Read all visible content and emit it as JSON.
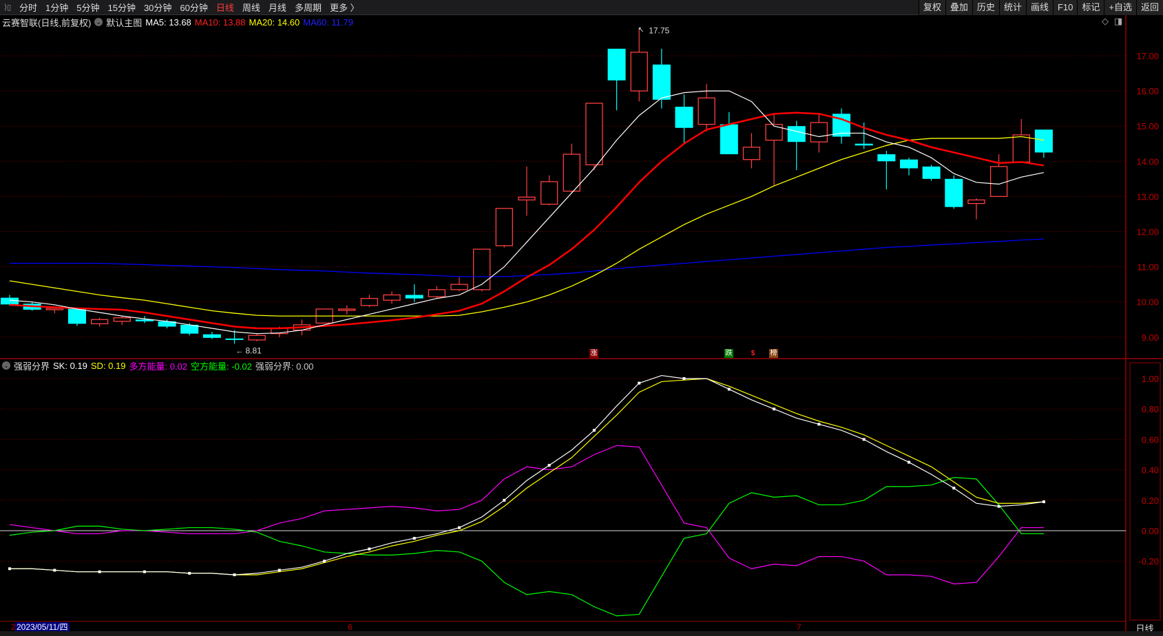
{
  "toolbar": {
    "periods": [
      "分时",
      "1分钟",
      "5分钟",
      "15分钟",
      "30分钟",
      "60分钟",
      "日线",
      "周线",
      "月线",
      "多周期",
      "更多 〉"
    ],
    "active": "日线",
    "buttons": [
      "复权",
      "叠加",
      "历史",
      "统计",
      "画线",
      "F10",
      "标记",
      "+自选",
      "返回"
    ]
  },
  "info": {
    "title": "云赛智联(日线,前复权)",
    "main_label": "默认主图",
    "ma5": "MA5: 13.68",
    "ma10": "MA10: 13.88",
    "ma20": "MA20: 14.60",
    "ma60": "MA60: 11.79"
  },
  "indicator": {
    "name": "强弱分界",
    "sk": "SK: 0.19",
    "sd": "SD: 0.19",
    "long": "多方能量: 0.02",
    "short": "空方能量: -0.02",
    "bound": "强弱分界: 0.00"
  },
  "tags": {
    "up": "涨",
    "down": "跌",
    "s": "$",
    "rank": "榜"
  },
  "annotations": {
    "high": "17.75",
    "low": "8.81"
  },
  "date_axis": {
    "current": "2023/05/11/四",
    "months": [
      "2",
      "6",
      "7"
    ],
    "period": "日线"
  },
  "colors": {
    "up": "#ff4040",
    "down": "#00ffff",
    "ma5": "#ffffff",
    "ma10": "#ff0000",
    "ma20": "#ffff00",
    "ma60": "#0000ff",
    "sk": "#ffffff",
    "sd": "#ffff00",
    "long": "#ff00ff",
    "short": "#00ff00"
  },
  "chart_data": [
    {
      "type": "candlestick",
      "title": "云赛智联 日线",
      "ylim": [
        8.6,
        17.9
      ],
      "yticks": [
        "17.00",
        "16.00",
        "15.00",
        "14.00",
        "13.00",
        "12.00",
        "11.00",
        "10.00",
        "9.00"
      ],
      "ohlc": [
        [
          10.12,
          10.2,
          9.9,
          9.93
        ],
        [
          9.95,
          10.0,
          9.75,
          9.78
        ],
        [
          9.78,
          9.85,
          9.68,
          9.82
        ],
        [
          9.82,
          9.85,
          9.32,
          9.38
        ],
        [
          9.38,
          9.55,
          9.3,
          9.5
        ],
        [
          9.45,
          9.6,
          9.35,
          9.55
        ],
        [
          9.5,
          9.6,
          9.4,
          9.45
        ],
        [
          9.45,
          9.5,
          9.25,
          9.3
        ],
        [
          9.35,
          9.4,
          9.05,
          9.1
        ],
        [
          9.08,
          9.15,
          8.95,
          8.98
        ],
        [
          8.96,
          9.2,
          8.81,
          8.95
        ],
        [
          8.92,
          9.1,
          8.88,
          9.05
        ],
        [
          9.1,
          9.3,
          9.0,
          9.25
        ],
        [
          9.2,
          9.5,
          9.05,
          9.35
        ],
        [
          9.4,
          9.8,
          9.4,
          9.8
        ],
        [
          9.8,
          9.9,
          9.65,
          9.8
        ],
        [
          9.9,
          10.2,
          9.85,
          10.1
        ],
        [
          10.05,
          10.3,
          9.95,
          10.2
        ],
        [
          10.2,
          10.5,
          10.0,
          10.1
        ],
        [
          10.15,
          10.45,
          10.1,
          10.35
        ],
        [
          10.35,
          10.7,
          10.3,
          10.5
        ],
        [
          10.35,
          11.5,
          10.3,
          11.5
        ],
        [
          11.6,
          12.66,
          11.55,
          12.66
        ],
        [
          12.9,
          13.85,
          12.45,
          12.98
        ],
        [
          12.78,
          13.6,
          12.75,
          13.42
        ],
        [
          13.15,
          14.5,
          13.1,
          14.2
        ],
        [
          13.9,
          15.65,
          13.75,
          15.65
        ],
        [
          17.2,
          17.2,
          15.45,
          16.3
        ],
        [
          16.0,
          17.75,
          15.7,
          17.1
        ],
        [
          16.75,
          17.2,
          15.5,
          15.75
        ],
        [
          15.55,
          15.9,
          14.5,
          14.95
        ],
        [
          15.05,
          16.2,
          14.85,
          15.8
        ],
        [
          15.05,
          15.4,
          14.2,
          14.2
        ],
        [
          14.05,
          14.8,
          13.8,
          14.4
        ],
        [
          14.6,
          15.35,
          13.3,
          15.05
        ],
        [
          15.0,
          15.15,
          13.75,
          14.55
        ],
        [
          14.55,
          15.35,
          14.25,
          15.1
        ],
        [
          15.35,
          15.5,
          14.5,
          14.7
        ],
        [
          14.5,
          15.1,
          14.35,
          14.45
        ],
        [
          14.2,
          14.3,
          13.2,
          14.0
        ],
        [
          14.05,
          14.1,
          13.6,
          13.8
        ],
        [
          13.85,
          13.9,
          13.45,
          13.5
        ],
        [
          13.5,
          13.6,
          12.65,
          12.7
        ],
        [
          12.8,
          12.95,
          12.35,
          12.9
        ],
        [
          13.0,
          14.2,
          13.0,
          13.85
        ],
        [
          13.98,
          15.2,
          13.95,
          14.75
        ],
        [
          14.9,
          14.9,
          14.1,
          14.25
        ]
      ],
      "ma5": [
        10.05,
        10.0,
        9.92,
        9.8,
        9.7,
        9.6,
        9.52,
        9.45,
        9.35,
        9.25,
        9.15,
        9.1,
        9.12,
        9.2,
        9.35,
        9.5,
        9.65,
        9.8,
        9.95,
        10.1,
        10.2,
        10.5,
        11.0,
        11.7,
        12.4,
        13.1,
        13.8,
        14.6,
        15.3,
        15.8,
        15.95,
        16.0,
        16.0,
        15.7,
        15.0,
        14.85,
        14.7,
        14.8,
        14.8,
        14.55,
        14.4,
        14.1,
        13.65,
        13.4,
        13.35,
        13.55,
        13.68
      ],
      "ma10": [
        9.92,
        9.88,
        9.85,
        9.82,
        9.8,
        9.78,
        9.7,
        9.6,
        9.5,
        9.4,
        9.3,
        9.25,
        9.25,
        9.28,
        9.32,
        9.36,
        9.42,
        9.48,
        9.55,
        9.65,
        9.75,
        9.95,
        10.3,
        10.7,
        11.05,
        11.5,
        12.05,
        12.7,
        13.4,
        14.0,
        14.5,
        14.9,
        15.05,
        15.2,
        15.35,
        15.38,
        15.35,
        15.2,
        14.95,
        14.75,
        14.6,
        14.4,
        14.25,
        14.1,
        13.95,
        13.98,
        13.88
      ],
      "ma20": [
        10.6,
        10.5,
        10.4,
        10.3,
        10.2,
        10.12,
        10.05,
        9.95,
        9.85,
        9.75,
        9.68,
        9.62,
        9.6,
        9.6,
        9.6,
        9.6,
        9.6,
        9.6,
        9.6,
        9.6,
        9.62,
        9.72,
        9.85,
        10.0,
        10.2,
        10.45,
        10.75,
        11.1,
        11.5,
        11.85,
        12.2,
        12.5,
        12.75,
        13.0,
        13.3,
        13.55,
        13.8,
        14.05,
        14.25,
        14.45,
        14.6,
        14.65,
        14.65,
        14.65,
        14.65,
        14.7,
        14.6
      ],
      "ma60": [
        11.1,
        11.1,
        11.1,
        11.1,
        11.1,
        11.08,
        11.06,
        11.04,
        11.02,
        11.0,
        10.98,
        10.95,
        10.92,
        10.9,
        10.88,
        10.85,
        10.82,
        10.8,
        10.78,
        10.75,
        10.72,
        10.72,
        10.72,
        10.75,
        10.78,
        10.82,
        10.88,
        10.95,
        11.0,
        11.05,
        11.1,
        11.15,
        11.2,
        11.25,
        11.3,
        11.35,
        11.4,
        11.45,
        11.5,
        11.55,
        11.58,
        11.62,
        11.65,
        11.69,
        11.72,
        11.76,
        11.79
      ]
    },
    {
      "type": "line",
      "title": "强弱分界",
      "ylim": [
        -0.3,
        1.1
      ],
      "yticks": [
        "1.00",
        "0.80",
        "0.60",
        "0.40",
        "0.20",
        "0.00",
        "-0.20"
      ],
      "series": [
        {
          "name": "SK",
          "values": [
            -0.25,
            -0.25,
            -0.26,
            -0.27,
            -0.27,
            -0.27,
            -0.27,
            -0.27,
            -0.28,
            -0.28,
            -0.29,
            -0.28,
            -0.26,
            -0.24,
            -0.2,
            -0.15,
            -0.12,
            -0.08,
            -0.05,
            -0.02,
            0.02,
            0.09,
            0.2,
            0.33,
            0.43,
            0.53,
            0.66,
            0.82,
            0.97,
            1.02,
            1.0,
            1.0,
            0.93,
            0.86,
            0.8,
            0.74,
            0.7,
            0.66,
            0.6,
            0.52,
            0.45,
            0.37,
            0.28,
            0.18,
            0.16,
            0.17,
            0.19
          ]
        },
        {
          "name": "SD",
          "values": [
            -0.25,
            -0.25,
            -0.26,
            -0.27,
            -0.27,
            -0.27,
            -0.27,
            -0.27,
            -0.28,
            -0.28,
            -0.29,
            -0.29,
            -0.27,
            -0.25,
            -0.21,
            -0.17,
            -0.14,
            -0.1,
            -0.07,
            -0.03,
            0.0,
            0.06,
            0.16,
            0.28,
            0.38,
            0.48,
            0.62,
            0.76,
            0.91,
            0.98,
            0.99,
            1.0,
            0.95,
            0.89,
            0.83,
            0.77,
            0.72,
            0.68,
            0.63,
            0.56,
            0.49,
            0.42,
            0.32,
            0.22,
            0.18,
            0.18,
            0.19
          ]
        },
        {
          "name": "多方能量",
          "values": [
            0.04,
            0.02,
            0.0,
            -0.02,
            -0.02,
            0.0,
            0.0,
            -0.01,
            -0.02,
            -0.02,
            -0.02,
            0.0,
            0.05,
            0.08,
            0.13,
            0.14,
            0.15,
            0.16,
            0.15,
            0.13,
            0.14,
            0.2,
            0.34,
            0.42,
            0.4,
            0.42,
            0.5,
            0.56,
            0.55,
            0.3,
            0.05,
            0.02,
            -0.18,
            -0.25,
            -0.22,
            -0.23,
            -0.17,
            -0.17,
            -0.2,
            -0.29,
            -0.29,
            -0.3,
            -0.35,
            -0.34,
            -0.17,
            0.02,
            0.02
          ]
        },
        {
          "name": "空方能量",
          "values": [
            -0.03,
            -0.01,
            0.0,
            0.03,
            0.03,
            0.01,
            0.0,
            0.01,
            0.02,
            0.02,
            0.01,
            -0.01,
            -0.07,
            -0.1,
            -0.14,
            -0.15,
            -0.16,
            -0.16,
            -0.15,
            -0.13,
            -0.14,
            -0.2,
            -0.34,
            -0.42,
            -0.4,
            -0.42,
            -0.5,
            -0.56,
            -0.55,
            -0.3,
            -0.05,
            -0.02,
            0.18,
            0.25,
            0.22,
            0.23,
            0.17,
            0.17,
            0.2,
            0.29,
            0.29,
            0.3,
            0.35,
            0.34,
            0.17,
            -0.02,
            -0.02
          ]
        }
      ]
    }
  ]
}
